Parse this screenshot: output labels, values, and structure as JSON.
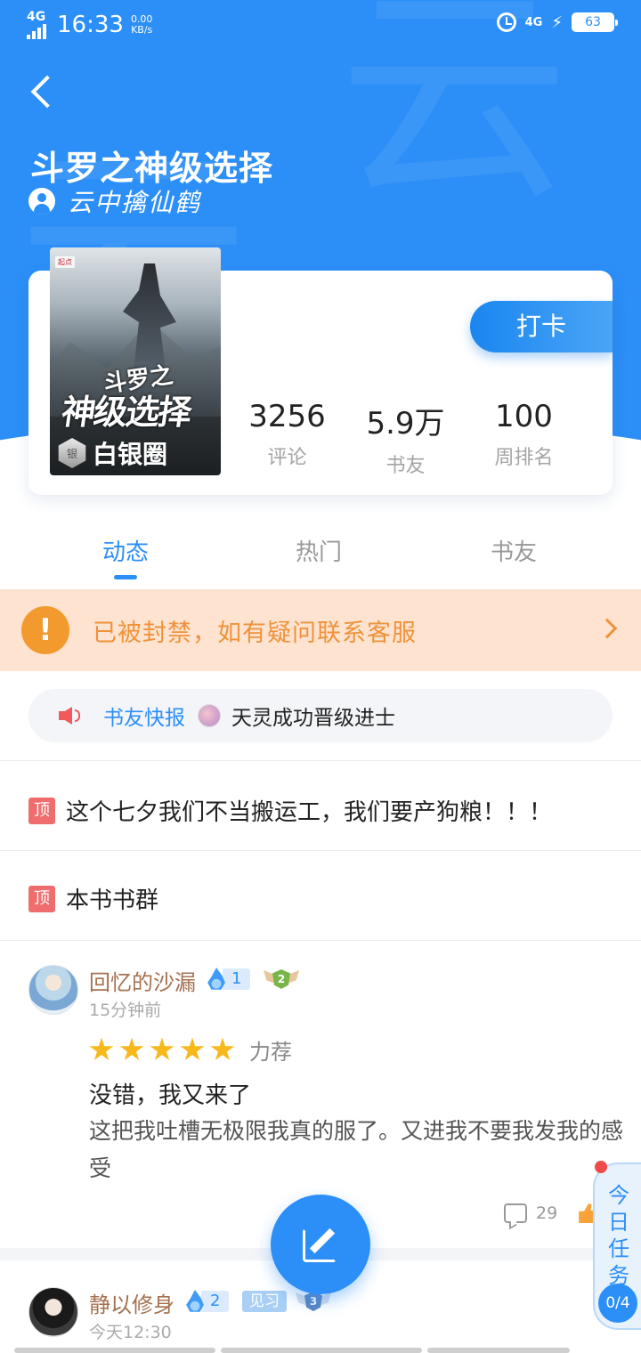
{
  "status_bar": {
    "network": "4G",
    "time": "16:33",
    "speed_value": "0.00",
    "speed_unit": "KB/s",
    "network2": "4G",
    "battery": "63"
  },
  "book": {
    "title": "斗罗之神级选择",
    "author": "云中擒仙鹤",
    "cover_title_top": "斗罗之",
    "cover_title_main": "神级选择",
    "circle_badge_icon": "银",
    "circle_badge": "白银圈"
  },
  "checkin_label": "打卡",
  "stats": [
    {
      "value": "3256",
      "label": "评论"
    },
    {
      "value": "5.9万",
      "label": "书友"
    },
    {
      "value": "100",
      "label": "周排名"
    }
  ],
  "tabs": [
    {
      "label": "动态",
      "active": true
    },
    {
      "label": "热门",
      "active": false
    },
    {
      "label": "书友",
      "active": false
    }
  ],
  "ban_notice": {
    "icon": "!",
    "text": "已被封禁，如有疑问联系客服"
  },
  "newsflash": {
    "label": "书友快报",
    "text": "天灵成功晋级进士"
  },
  "pinned": [
    {
      "tag": "顶",
      "text": "这个七夕我们不当搬运工，我们要产狗粮！！！"
    },
    {
      "tag": "顶",
      "text": "本书书群"
    }
  ],
  "posts": [
    {
      "username": "回忆的沙漏",
      "level": "1",
      "rank": "2",
      "time": "15分钟前",
      "rating": 5,
      "rating_label": "力荐",
      "title": "没错，我又来了",
      "body": "这把我吐槽无极限我真的服了。又进我不要我发我的感受",
      "comments": "29"
    },
    {
      "username": "静以修身",
      "level": "2",
      "tag": "见习",
      "rank": "3",
      "time": "今天12:30"
    }
  ],
  "daily_task": {
    "label": "今日任务",
    "progress": "0/4"
  },
  "colors": {
    "primary": "#2c8ff7",
    "ban_bg": "#fde3d0",
    "ban_text": "#f0923a",
    "pin_tag": "#f06d6d",
    "star": "#f7b81c",
    "username": "#a5714f"
  }
}
